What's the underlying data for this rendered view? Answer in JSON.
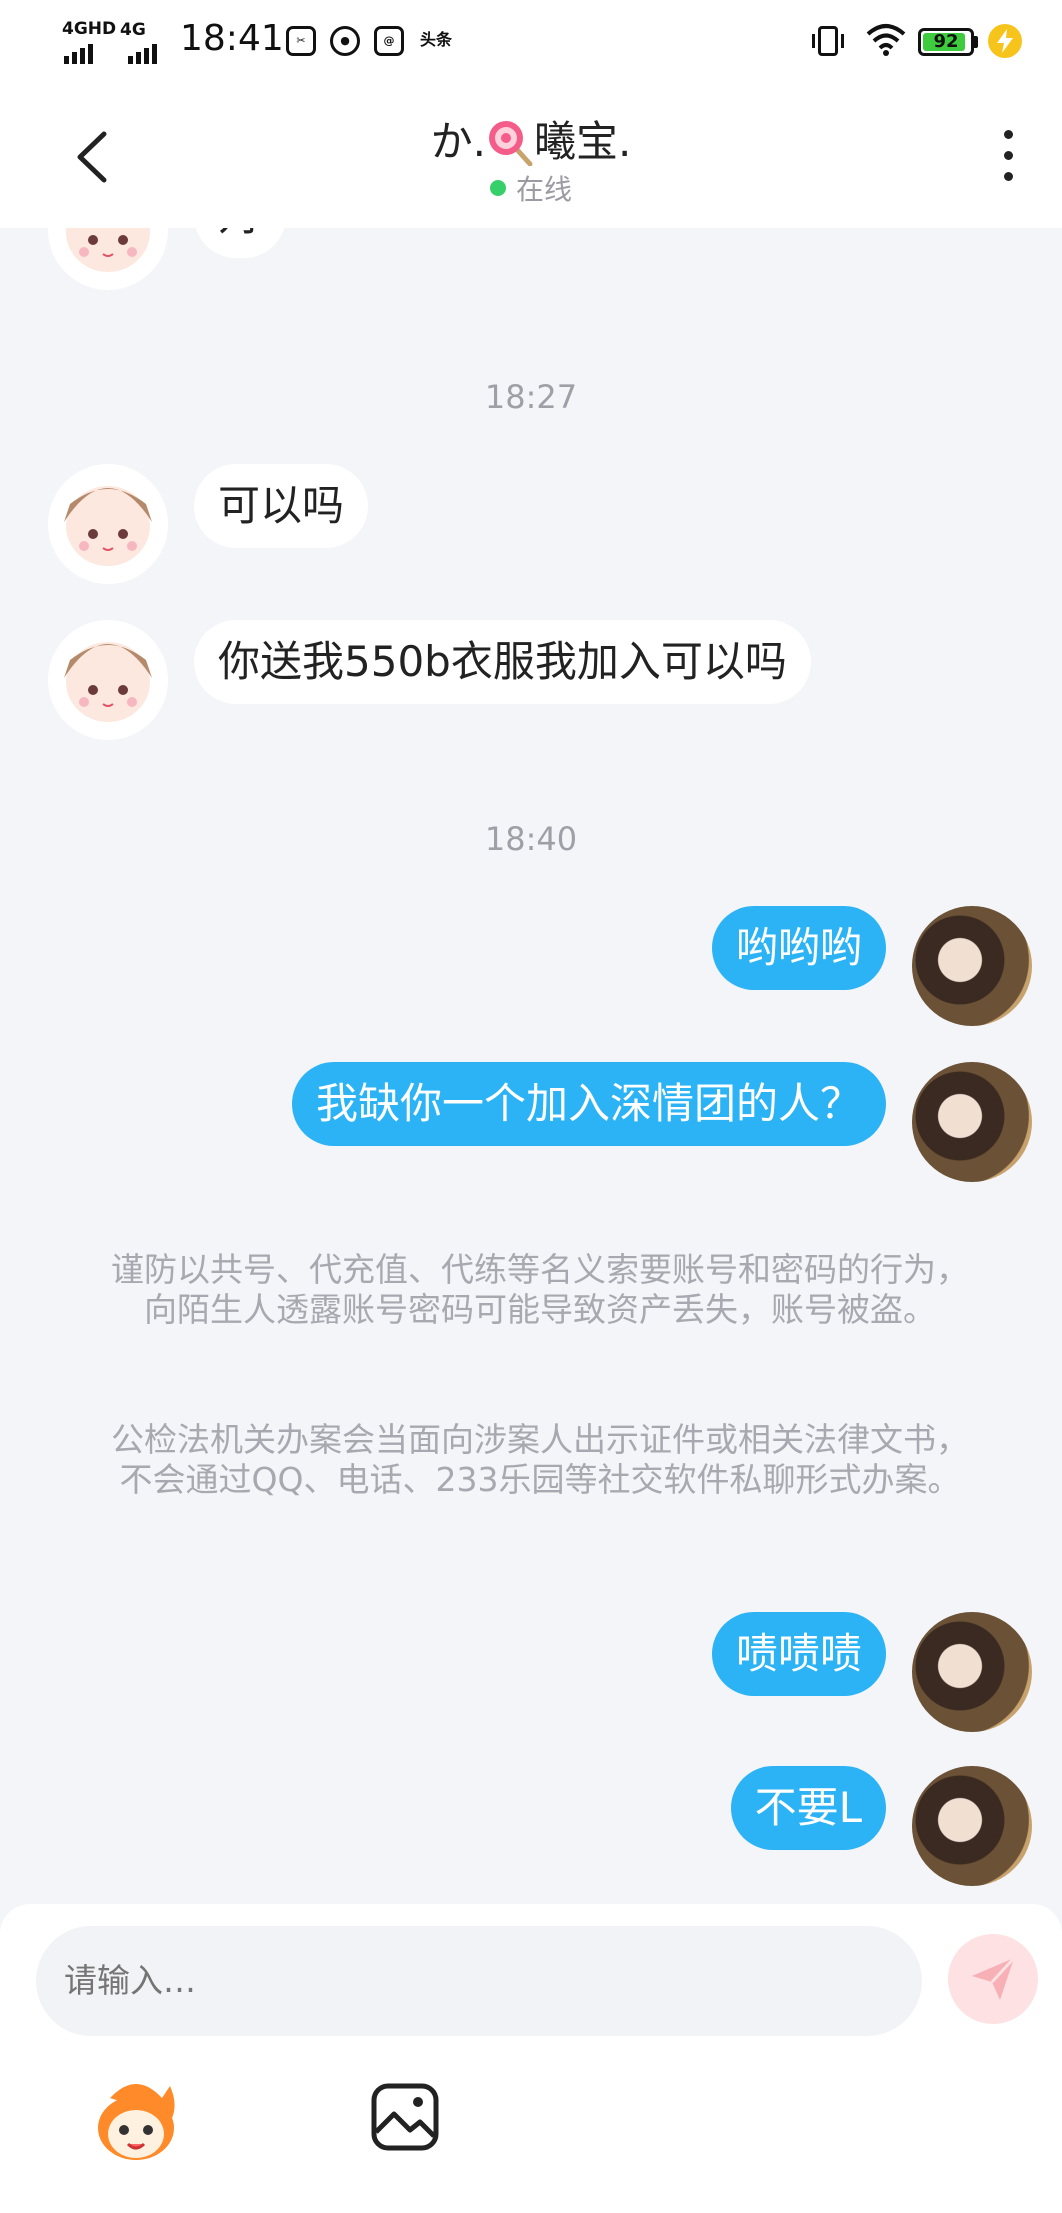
{
  "status_bar": {
    "network_1": "4GHD",
    "network_2": "4G",
    "time": "18:41",
    "battery": "92",
    "app_icons": [
      "scissors-icon",
      "wechat-icon",
      "qq-mail-icon",
      "toutiao-icon"
    ],
    "toutiao_label": "头条"
  },
  "header": {
    "title_prefix": "か.",
    "title_emoji": "lollipop-icon",
    "title_suffix": "曦宝.",
    "status": "在线"
  },
  "messages": [
    {
      "type": "partial",
      "side": "in",
      "text": "对"
    },
    {
      "type": "time",
      "text": "18:27"
    },
    {
      "type": "text",
      "side": "in",
      "text": "可以吗"
    },
    {
      "type": "text",
      "side": "in",
      "text": "你送我550b衣服我加入可以吗"
    },
    {
      "type": "time",
      "text": "18:40"
    },
    {
      "type": "text",
      "side": "out",
      "text": "哟哟哟"
    },
    {
      "type": "text",
      "side": "out",
      "text": "我缺你一个加入深情团的人？"
    },
    {
      "type": "notice",
      "text": "谨防以共号、代充值、代练等名义索要账号和密码的行为，向陌生人透露账号密码可能导致资产丢失，账号被盗。"
    },
    {
      "type": "notice",
      "text": "公检法机关办案会当面向涉案人出示证件或相关法律文书，不会通过QQ、电话、233乐园等社交软件私聊形式办案。"
    },
    {
      "type": "text",
      "side": "out",
      "text": "啧啧啧"
    },
    {
      "type": "text",
      "side": "out",
      "text": "不要L"
    }
  ],
  "input": {
    "placeholder": "请输入…"
  },
  "colors": {
    "accent": "#2bb3f5",
    "background": "#f4f5f9",
    "online": "#35d06a",
    "send_disabled": "#fde1e3"
  }
}
